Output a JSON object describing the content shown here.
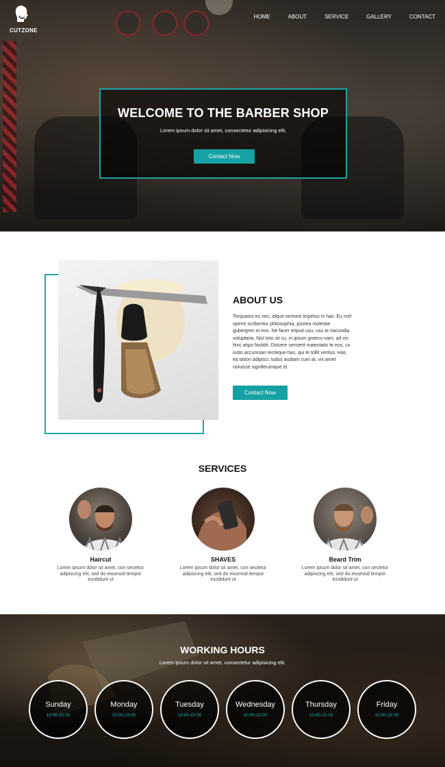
{
  "brand": {
    "name": "CUTZONE"
  },
  "nav": {
    "items": [
      "HOME",
      "ABOUT",
      "SERVICE",
      "GALLERY",
      "CONTACT"
    ]
  },
  "hero": {
    "title": "WELCOME TO THE BARBER SHOP",
    "subtitle": "Lorem ipsum dolor sit amet, consectetur adipisicing elit,",
    "button": "Contact Now"
  },
  "about": {
    "title": "ABOUT US",
    "lines": [
      "Torquatos eu nec, idque nemore impetus in has. Eu mel",
      "operiri scribentur philosophia, postea molestie",
      "gubergren ei eos. Ne facer eripuit usu, usu te iracundia",
      "voluptaria. Nisl toto sit cu, in ipsum graeco nam, ad vis",
      "hinc atqui fastidii. Discere senserit maiestatis te eos, cu",
      "iusto accumsan recteque has, qui te tollit veritus. Has",
      "ea tation adipisci, ludus audiam cum at, vix amet",
      "noluisse signiferumque id."
    ],
    "button": "Contact Now"
  },
  "services": {
    "title": "SERVICES",
    "items": [
      {
        "name": "Haircut",
        "desc1": "Lorem ipsum dolor sit amet, con sectetur",
        "desc2": "adipiscing elit, sed do eiusmod tempor",
        "desc3": "incididunt ut"
      },
      {
        "name": "SHAVES",
        "desc1": "Lorem ipsum dolor sit amet, con sectetur",
        "desc2": "adipiscing elit, sed do eiusmod tempor",
        "desc3": "incididunt ut"
      },
      {
        "name": "Beard Trim",
        "desc1": "Lorem ipsum dolor sit amet, con sectetur",
        "desc2": "adipiscing elit, sed do eiusmod tempor",
        "desc3": "incididunt ut"
      }
    ]
  },
  "hours": {
    "title": "WORKING HOURS",
    "subtitle": "Lorem ipsum dolor sit amet, consectetur adipisicing elit.",
    "days": [
      {
        "day": "Sunday",
        "time": "10:00-22:00"
      },
      {
        "day": "Monday",
        "time": "10:00-22:00"
      },
      {
        "day": "Tuesday",
        "time": "10:00-22:00"
      },
      {
        "day": "Wednesday",
        "time": "10:00-22:00"
      },
      {
        "day": "Thursday",
        "time": "10:00-22:00"
      },
      {
        "day": "Friday",
        "time": "10:00-22:00"
      }
    ]
  },
  "colors": {
    "accent": "#16a1a4",
    "dark": "#111111"
  },
  "icons": {
    "logo": "barber-head-icon"
  }
}
